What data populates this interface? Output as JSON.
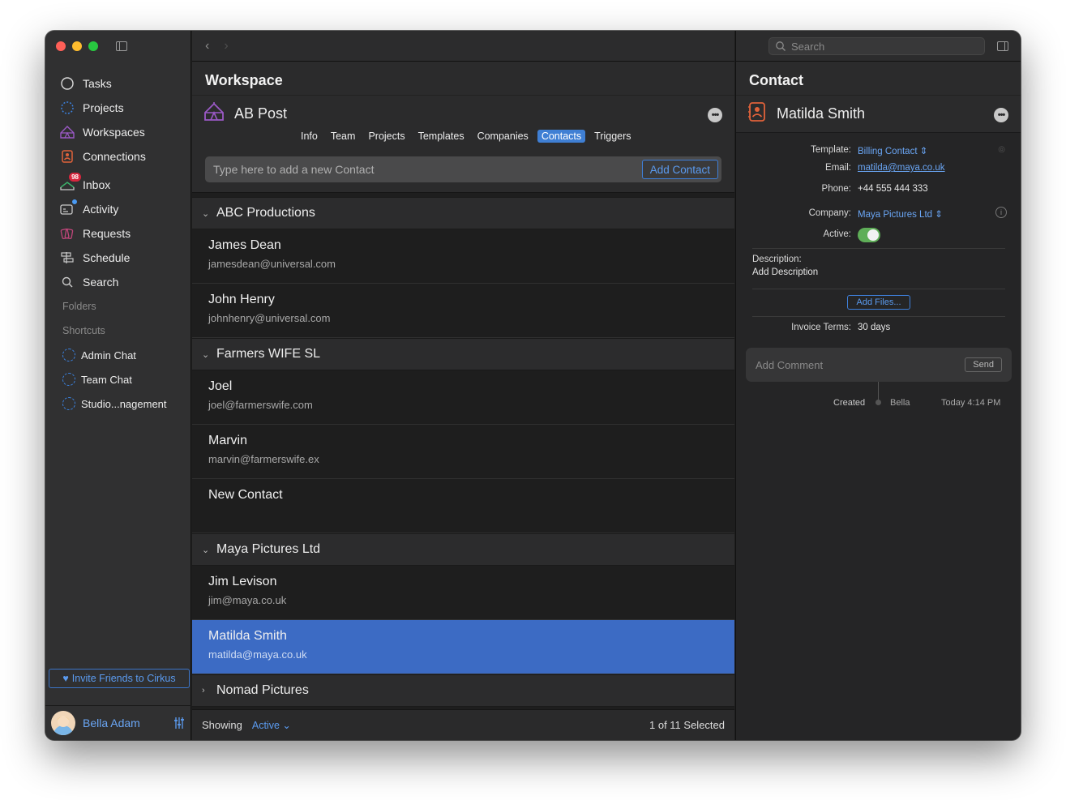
{
  "sidebar": {
    "items": [
      {
        "label": "Tasks",
        "icon": "circle-icon"
      },
      {
        "label": "Projects",
        "icon": "dashed-circle-icon"
      },
      {
        "label": "Workspaces",
        "icon": "tent-icon"
      },
      {
        "label": "Connections",
        "icon": "contact-card-icon"
      },
      {
        "label": "Inbox",
        "icon": "inbox-icon",
        "badge": "98"
      },
      {
        "label": "Activity",
        "icon": "activity-icon"
      },
      {
        "label": "Requests",
        "icon": "requests-icon"
      },
      {
        "label": "Schedule",
        "icon": "schedule-icon"
      },
      {
        "label": "Search",
        "icon": "search-icon"
      }
    ],
    "folders_label": "Folders",
    "shortcuts_label": "Shortcuts",
    "shortcuts": [
      {
        "label": "Admin Chat"
      },
      {
        "label": "Team Chat"
      },
      {
        "label": "Studio...nagement"
      }
    ],
    "invite_label": "Invite Friends to Cirkus",
    "user_name": "Bella Adam"
  },
  "workspace": {
    "title": "Workspace",
    "name": "AB Post",
    "tabs": [
      "Info",
      "Team",
      "Projects",
      "Templates",
      "Companies",
      "Contacts",
      "Triggers"
    ],
    "active_tab": "Contacts",
    "add_placeholder": "Type here to add a new Contact",
    "add_button": "Add Contact"
  },
  "groups": [
    {
      "name": "ABC Productions",
      "expanded": true,
      "contacts": [
        {
          "name": "James Dean",
          "email": "jamesdean@universal.com"
        },
        {
          "name": "John Henry",
          "email": "johnhenry@universal.com"
        }
      ]
    },
    {
      "name": "Farmers WIFE SL",
      "expanded": true,
      "contacts": [
        {
          "name": "Joel",
          "email": "joel@farmerswife.com"
        },
        {
          "name": "Marvin",
          "email": "marvin@farmerswife.ex"
        },
        {
          "name": "New Contact",
          "email": ""
        }
      ]
    },
    {
      "name": "Maya Pictures Ltd",
      "expanded": true,
      "contacts": [
        {
          "name": "Jim Levison",
          "email": "jim@maya.co.uk"
        },
        {
          "name": "Matilda Smith",
          "email": "matilda@maya.co.uk",
          "selected": true
        }
      ]
    },
    {
      "name": "Nomad Pictures",
      "expanded": false,
      "contacts": []
    }
  ],
  "footer": {
    "showing_label": "Showing",
    "filter_value": "Active",
    "count_text": "1 of 11 Selected"
  },
  "search": {
    "placeholder": "Search"
  },
  "contact": {
    "title": "Contact",
    "name": "Matilda Smith",
    "template_label": "Template:",
    "template_value": "Billing Contact",
    "email_label": "Email:",
    "email_value": "matilda@maya.co.uk",
    "phone_label": "Phone:",
    "phone_value": "+44 555 444 333",
    "company_label": "Company:",
    "company_value": "Maya Pictures Ltd",
    "active_label": "Active:",
    "active": true,
    "description_label": "Description:",
    "description_value": "Add Description",
    "add_files": "Add Files...",
    "invoice_label": "Invoice Terms:",
    "invoice_value": "30 days",
    "comment_placeholder": "Add Comment",
    "send": "Send",
    "activity": {
      "action": "Created",
      "user": "Bella",
      "time": "Today 4:14 PM"
    }
  },
  "colors": {
    "accent": "#3f7fd4",
    "selected_row": "#3c6bc4",
    "toggle_on": "#5fae58",
    "badge": "#d7263d"
  }
}
